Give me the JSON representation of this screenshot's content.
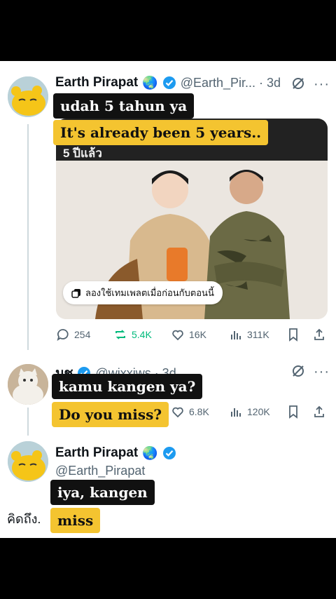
{
  "tweet1": {
    "display_name": "Earth Pirapat",
    "globe_emoji": "🌏",
    "handle_time": "@Earth_Pir... · 3d",
    "caption_original": "udah 5 tahun ya",
    "caption_translation": "It's already been 5 years..",
    "image_header_text": "5 ปีแล้ว",
    "template_pill_text": "ลองใช้เทมเพลตเมื่อก่อนกับตอนนี้",
    "stats": {
      "replies": "254",
      "reposts": "5.4K",
      "likes": "16K",
      "views": "311K"
    }
  },
  "tweet2": {
    "display_name": "มช",
    "handle_time": "@wixxiws · 3d",
    "caption_original": "kamu kangen ya?",
    "caption_translation": "Do you miss?",
    "stats": {
      "likes": "6.8K",
      "views": "120K"
    }
  },
  "tweet3": {
    "display_name": "Earth Pirapat",
    "globe_emoji": "🌏",
    "handle": "@Earth_Pirapat",
    "body_text": "คิดถึง.",
    "caption_original": "iya, kangen",
    "caption_translation": "miss"
  },
  "colors": {
    "accent_blue": "#1d9bf0",
    "repost_green": "#00ba7c",
    "caption_yellow": "#f4c430",
    "caption_black": "#111111"
  }
}
